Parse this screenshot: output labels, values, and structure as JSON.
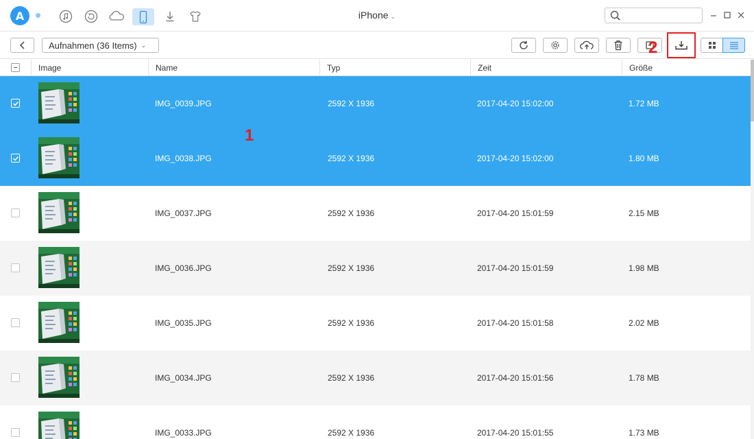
{
  "app": {
    "logo_letter": "A",
    "device_title": "iPhone",
    "search": {
      "value": "",
      "placeholder": ""
    }
  },
  "nav_icons": [
    "music-icon",
    "history-icon",
    "cloud-icon",
    "phone-icon",
    "download-icon",
    "shirt-icon"
  ],
  "toolbar": {
    "folder_label": "Aufnahmen (36 Items)",
    "tools": [
      "refresh-icon",
      "settings-icon",
      "upload-cloud-icon",
      "trash-icon",
      "transfer-icon",
      "download-to-pc-icon"
    ],
    "view_modes": [
      "grid-view-icon",
      "list-view-icon"
    ],
    "active_view": "list"
  },
  "annotations": {
    "step1": "1",
    "step2": "2"
  },
  "table": {
    "headers": {
      "image": "Image",
      "name": "Name",
      "type": "Typ",
      "time": "Zeit",
      "size": "Größe"
    },
    "rows": [
      {
        "name": "IMG_0039.JPG",
        "type": "2592 X 1936",
        "time": "2017-04-20 15:02:00",
        "size": "1.72 MB",
        "selected": true
      },
      {
        "name": "IMG_0038.JPG",
        "type": "2592 X 1936",
        "time": "2017-04-20 15:02:00",
        "size": "1.80 MB",
        "selected": true
      },
      {
        "name": "IMG_0037.JPG",
        "type": "2592 X 1936",
        "time": "2017-04-20 15:01:59",
        "size": "2.15 MB",
        "selected": false
      },
      {
        "name": "IMG_0036.JPG",
        "type": "2592 X 1936",
        "time": "2017-04-20 15:01:59",
        "size": "1.98 MB",
        "selected": false
      },
      {
        "name": "IMG_0035.JPG",
        "type": "2592 X 1936",
        "time": "2017-04-20 15:01:58",
        "size": "2.02 MB",
        "selected": false
      },
      {
        "name": "IMG_0034.JPG",
        "type": "2592 X 1936",
        "time": "2017-04-20 15:01:56",
        "size": "1.78 MB",
        "selected": false
      },
      {
        "name": "IMG_0033.JPG",
        "type": "2592 X 1936",
        "time": "2017-04-20 15:01:55",
        "size": "1.73 MB",
        "selected": false
      }
    ]
  },
  "colors": {
    "accent": "#35a7f0",
    "highlight": "#e02020",
    "selected_view": "#cfe6fa"
  }
}
